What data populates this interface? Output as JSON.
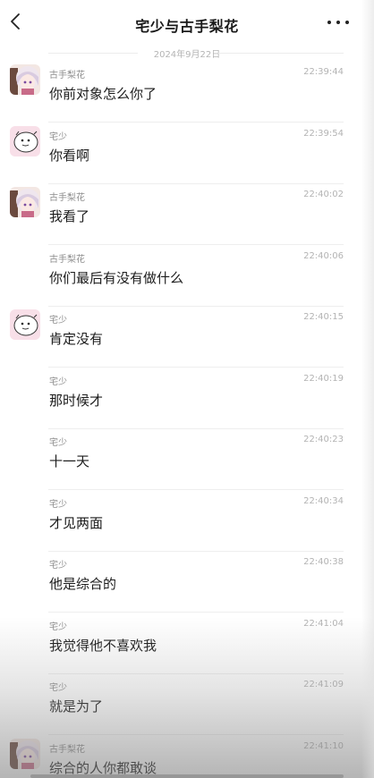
{
  "header": {
    "title": "宅少与古手梨花",
    "back_icon": "chevron-left-icon",
    "more_icon": "more-dots-icon"
  },
  "date_divider": "2024年9月22日",
  "records": [
    {
      "name": "古手梨花",
      "time": "22:39:44",
      "message": "你前对象怎么你了",
      "avatar": "anime-girl"
    },
    {
      "name": "宅少",
      "time": "22:39:54",
      "message": "你看啊",
      "avatar": "cartoon-face"
    },
    {
      "name": "古手梨花",
      "time": "22:40:02",
      "message": "我看了",
      "avatar": "anime-girl"
    },
    {
      "name": "古手梨花",
      "time": "22:40:06",
      "message": "你们最后有没有做什么",
      "avatar": ""
    },
    {
      "name": "宅少",
      "time": "22:40:15",
      "message": "肯定没有",
      "avatar": "cartoon-face"
    },
    {
      "name": "宅少",
      "time": "22:40:19",
      "message": "那时候才",
      "avatar": ""
    },
    {
      "name": "宅少",
      "time": "22:40:23",
      "message": "十一天",
      "avatar": ""
    },
    {
      "name": "宅少",
      "time": "22:40:34",
      "message": "才见两面",
      "avatar": ""
    },
    {
      "name": "宅少",
      "time": "22:40:38",
      "message": "他是综合的",
      "avatar": ""
    },
    {
      "name": "宅少",
      "time": "22:41:04",
      "message": "我觉得他不喜欢我",
      "avatar": ""
    },
    {
      "name": "宅少",
      "time": "22:41:09",
      "message": "就是为了",
      "avatar": ""
    },
    {
      "name": "古手梨花",
      "time": "22:41:10",
      "message": "综合的人你都敢谈",
      "avatar": "anime-girl"
    }
  ]
}
